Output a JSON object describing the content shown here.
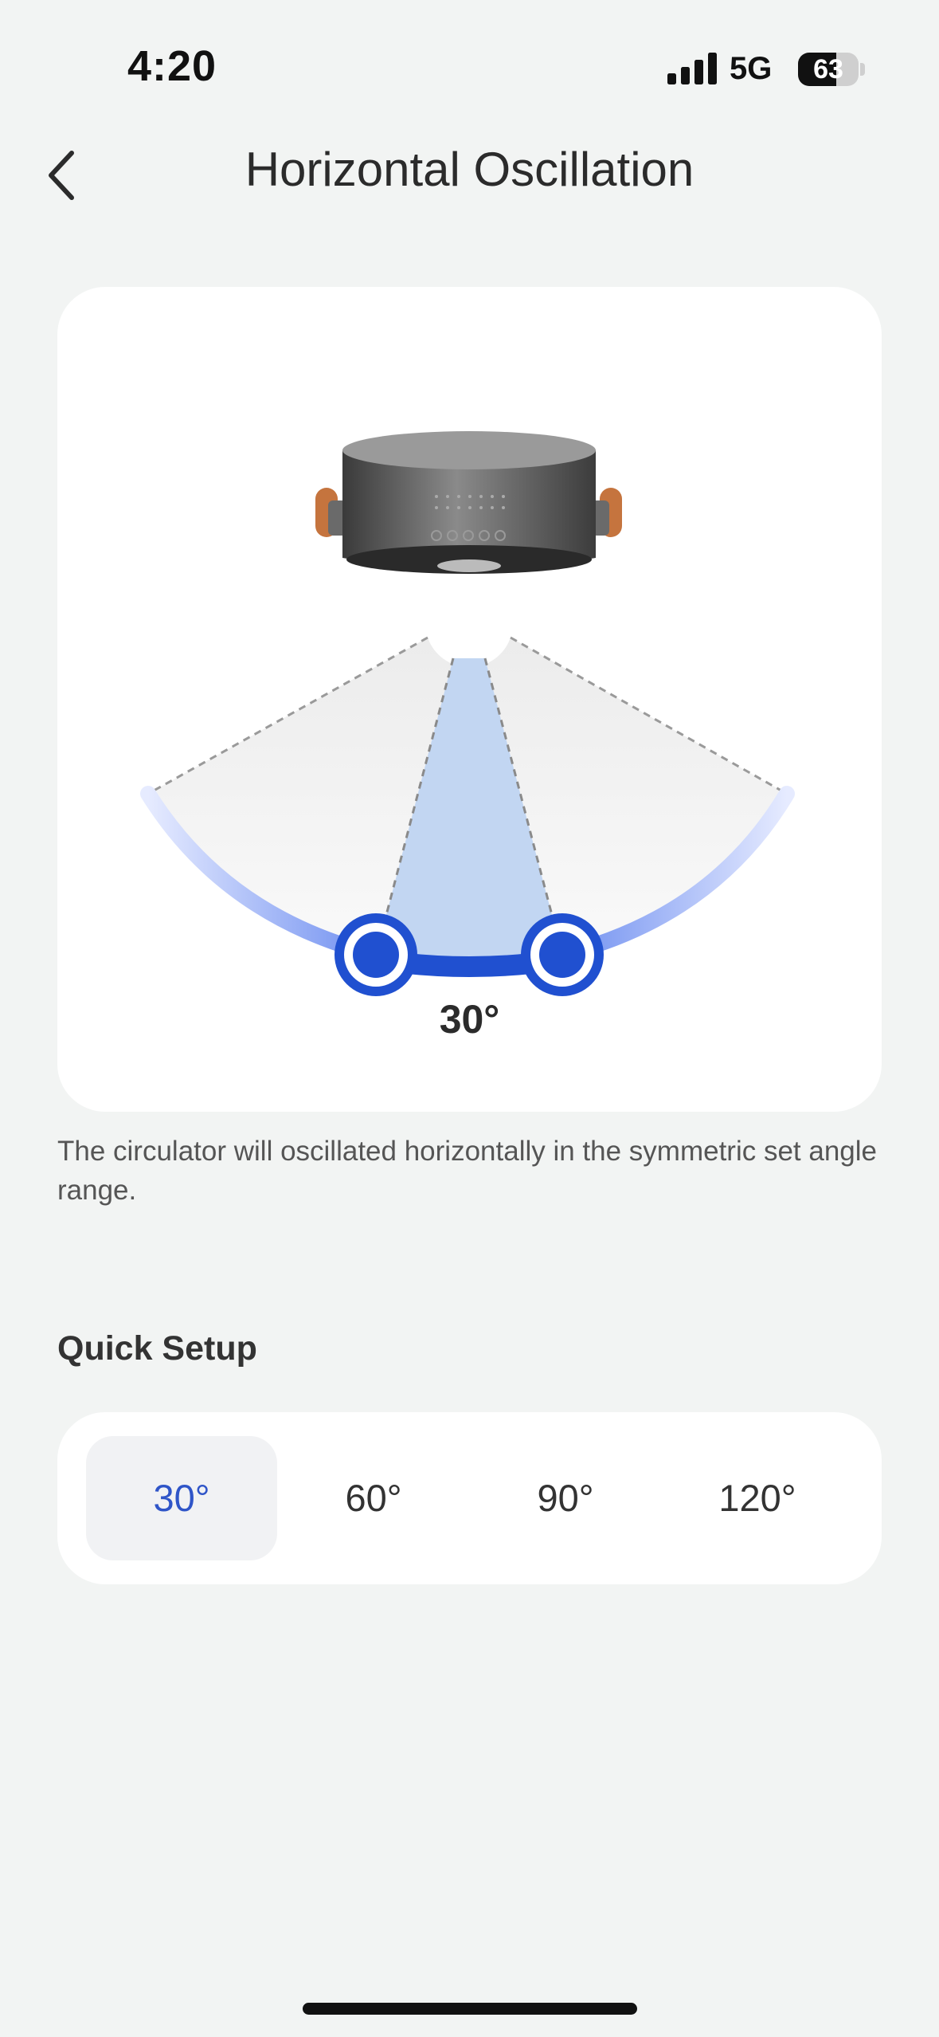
{
  "status_bar": {
    "time": "4:20",
    "network": "5G",
    "battery_level": 63,
    "battery_text": "63"
  },
  "header": {
    "title": "Horizontal Oscillation",
    "back_icon": "chevron-left-icon"
  },
  "illustration": {
    "angle_label": "30°",
    "colors": {
      "accent": "#2050d0",
      "range_fill": "#c2d6f2",
      "arc_light": "#d4ddfb"
    }
  },
  "description": "The circulator will oscillated horizontally in the symmetric set angle range.",
  "quick_setup": {
    "title": "Quick Setup",
    "options": [
      "30°",
      "60°",
      "90°",
      "120°"
    ],
    "selected": "30°"
  }
}
